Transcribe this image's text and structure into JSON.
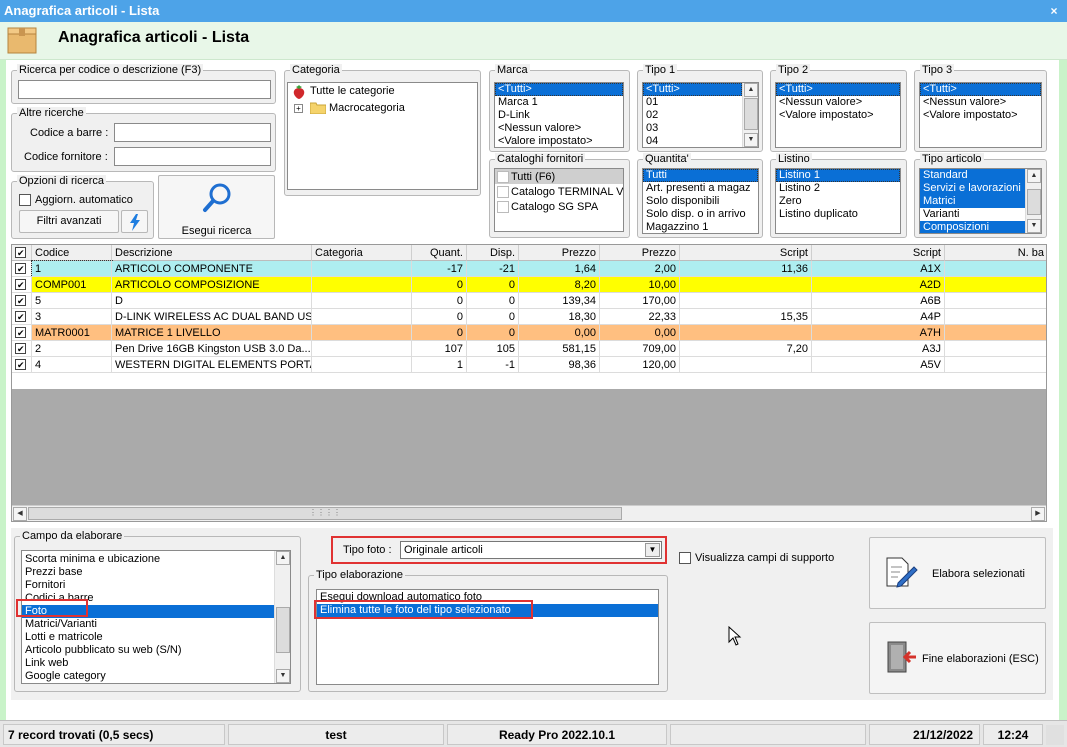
{
  "window": {
    "title": "Anagrafica articoli  - Lista",
    "close": "×"
  },
  "header": {
    "title": "Anagrafica articoli  - Lista"
  },
  "search": {
    "group_title": "Ricerca per codice o descrizione (F3)",
    "value": "",
    "other_title": "Altre ricerche",
    "barcode_label": "Codice a barre :",
    "supplier_code_label": "Codice fornitore :",
    "options_title": "Opzioni di ricerca",
    "auto_update_label": "Aggiorn. automatico",
    "advanced_filters_label": "Filtri avanzati",
    "search_button_label": "Esegui ricerca"
  },
  "categoria": {
    "title": "Categoria",
    "root": "Tutte le categorie",
    "child": "Macrocategoria",
    "expander": "+"
  },
  "filters": {
    "marca": {
      "title": "Marca",
      "items": [
        "<Tutti>",
        "Marca 1",
        "D-Link",
        "<Nessun valore>",
        "<Valore impostato>"
      ],
      "selected": [
        0
      ]
    },
    "tipo1": {
      "title": "Tipo 1",
      "items": [
        "<Tutti>",
        "01",
        "02",
        "03",
        "04"
      ],
      "selected": [
        0
      ]
    },
    "tipo2": {
      "title": "Tipo 2",
      "items": [
        "<Tutti>",
        "<Nessun valore>",
        "<Valore impostato>"
      ],
      "selected": [
        0
      ]
    },
    "tipo3": {
      "title": "Tipo 3",
      "items": [
        "<Tutti>",
        "<Nessun valore>",
        "<Valore impostato>"
      ],
      "selected": [
        0
      ]
    },
    "cataloghi": {
      "title": "Cataloghi fornitori",
      "items": [
        "Tutti (F6)",
        "Catalogo TERMINAL VID",
        "Catalogo SG SPA"
      ],
      "selected": [
        0
      ]
    },
    "quantita": {
      "title": "Quantita'",
      "items": [
        "Tutti",
        "Art. presenti a magaz",
        "Solo disponibili",
        "Solo disp. o in arrivo",
        "Magazzino 1"
      ],
      "selected": [
        0
      ]
    },
    "listino": {
      "title": "Listino",
      "items": [
        "Listino 1",
        "Listino 2",
        "Zero",
        "Listino duplicato"
      ],
      "selected": [
        0
      ]
    },
    "tipo_articolo": {
      "title": "Tipo articolo",
      "items": [
        "Standard",
        "Servizi e lavorazioni",
        "Matrici",
        "Varianti",
        "Composizioni"
      ],
      "selected": [
        0,
        1,
        2,
        4
      ]
    }
  },
  "grid": {
    "columns": [
      "Codice",
      "Descrizione",
      "Categoria",
      "Quant.",
      "Disp.",
      "Prezzo",
      "Prezzo",
      "Script",
      "Script",
      "N. ba"
    ],
    "rows": [
      {
        "codice": "1",
        "descrizione": "ARTICOLO COMPONENTE",
        "categoria": "",
        "quant": "-17",
        "disp": "-21",
        "prezzo1": "1,64",
        "prezzo2": "2,00",
        "script1": "11,36",
        "script2": "A1X",
        "color": "#aeeef0"
      },
      {
        "codice": "COMP001",
        "descrizione": "ARTICOLO COMPOSIZIONE",
        "categoria": "",
        "quant": "0",
        "disp": "0",
        "prezzo1": "8,20",
        "prezzo2": "10,00",
        "script1": "",
        "script2": "A2D",
        "color": "#ffff00"
      },
      {
        "codice": "5",
        "descrizione": "D",
        "categoria": "",
        "quant": "0",
        "disp": "0",
        "prezzo1": "139,34",
        "prezzo2": "170,00",
        "script1": "",
        "script2": "A6B",
        "color": "#ffffff"
      },
      {
        "codice": "3",
        "descrizione": "D-LINK WIRELESS AC DUAL BAND US...",
        "categoria": "",
        "quant": "0",
        "disp": "0",
        "prezzo1": "18,30",
        "prezzo2": "22,33",
        "script1": "15,35",
        "script2": "A4P",
        "color": "#ffffff"
      },
      {
        "codice": "MATR0001",
        "descrizione": "MATRICE 1 LIVELLO",
        "categoria": "",
        "quant": "0",
        "disp": "0",
        "prezzo1": "0,00",
        "prezzo2": "0,00",
        "script1": "",
        "script2": "A7H",
        "color": "#ffbf80"
      },
      {
        "codice": "2",
        "descrizione": "Pen Drive 16GB  Kingston  USB 3.0 Da...",
        "categoria": "",
        "quant": "107",
        "disp": "105",
        "prezzo1": "581,15",
        "prezzo2": "709,00",
        "script1": "7,20",
        "script2": "A3J",
        "color": "#ffffff"
      },
      {
        "codice": "4",
        "descrizione": "WESTERN DIGITAL ELEMENTS PORTA...",
        "categoria": "",
        "quant": "1",
        "disp": "-1",
        "prezzo1": "98,36",
        "prezzo2": "120,00",
        "script1": "",
        "script2": "A5V",
        "color": "#ffffff"
      }
    ]
  },
  "campo": {
    "title": "Campo da elaborare",
    "items": [
      "Scorta minima e ubicazione",
      "Prezzi base",
      "Fornitori",
      "Codici a barre",
      "Foto",
      "Matrici/Varianti",
      "Lotti e matricole",
      "Articolo pubblicato su web (S/N)",
      "Link web",
      "Google category"
    ],
    "selected": 4
  },
  "tipo_foto": {
    "label": "Tipo foto :",
    "value": "Originale articoli"
  },
  "visualizza_label": "Visualizza campi di supporto",
  "tipo_elaborazione": {
    "title": "Tipo elaborazione",
    "items": [
      "Esegui download automatico foto",
      "Elimina tutte le foto del tipo selezionato"
    ],
    "selected": 1
  },
  "actions": {
    "elabora": "Elabora selezionati",
    "fine": "Fine elaborazioni (ESC)"
  },
  "status": {
    "records": "7 record trovati (0,5 secs)",
    "user": "test",
    "version": "Ready Pro 2022.10.1",
    "date": "21/12/2022",
    "time": "12:24"
  }
}
